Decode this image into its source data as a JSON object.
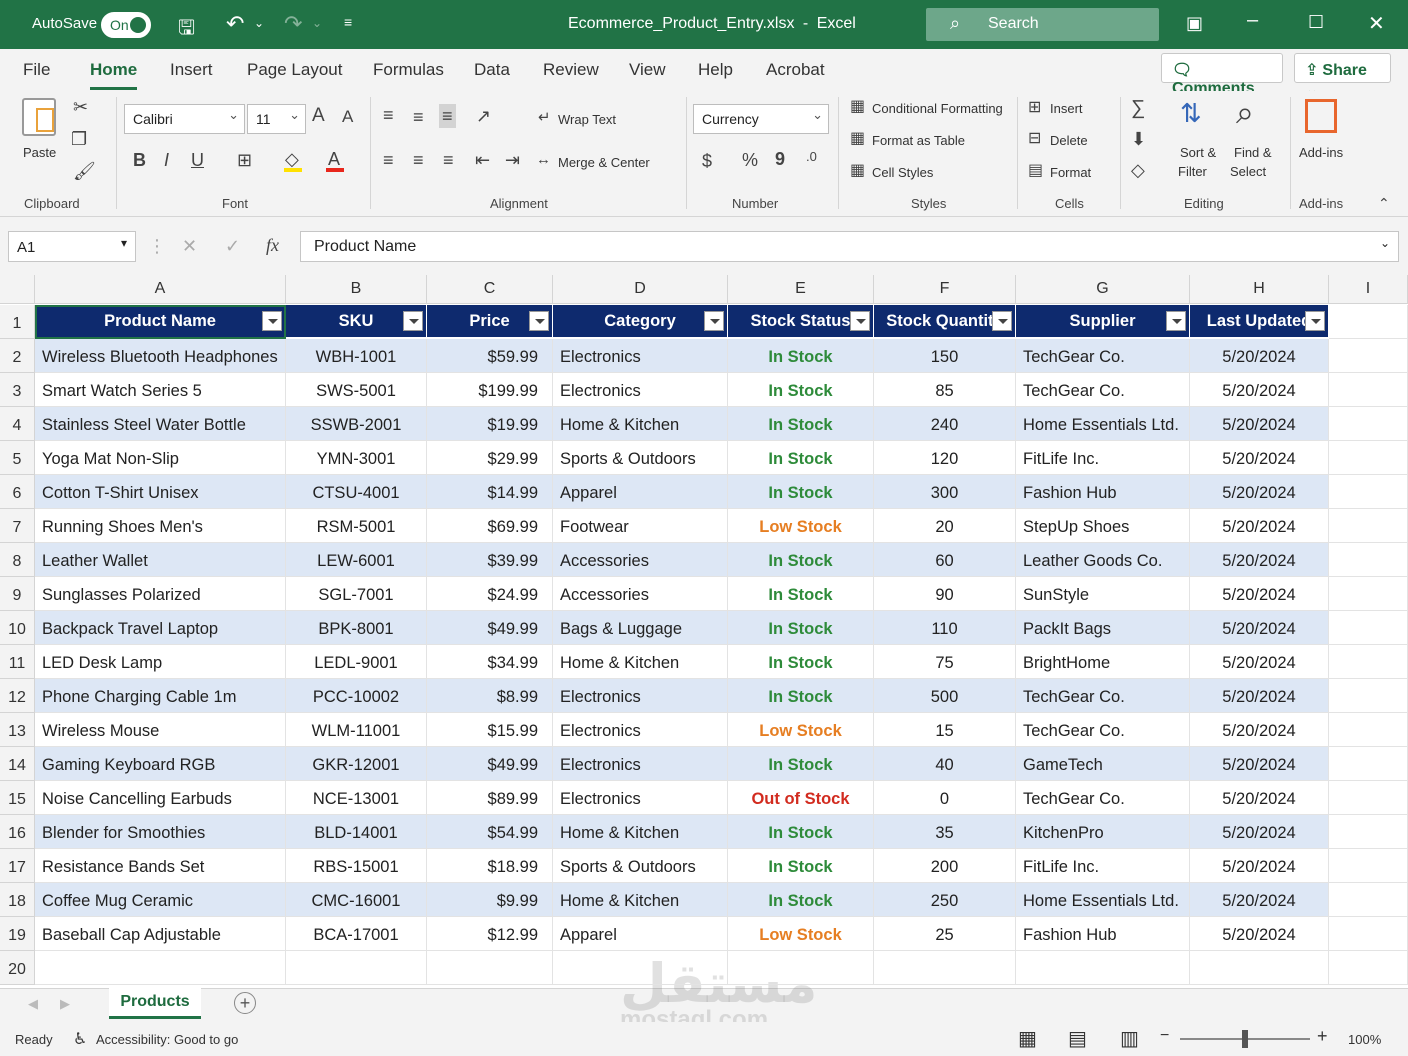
{
  "titlebar": {
    "autosave_label": "AutoSave",
    "autosave_state": "On",
    "filename": "Ecommerce_Product_Entry.xlsx",
    "separator": "-",
    "app": "Excel",
    "search_placeholder": "Search"
  },
  "menu": {
    "tabs": [
      "File",
      "Home",
      "Insert",
      "Page Layout",
      "Formulas",
      "Data",
      "Review",
      "View",
      "Help",
      "Acrobat"
    ],
    "comments": "Comments",
    "share": "Share"
  },
  "ribbon": {
    "clipboard": {
      "paste": "Paste",
      "group": "Clipboard"
    },
    "font": {
      "name": "Calibri",
      "size": "11",
      "group": "Font",
      "bold": "B",
      "italic": "I",
      "underline": "U",
      "grow": "A",
      "shrink": "A"
    },
    "alignment": {
      "wrap": "Wrap Text",
      "merge": "Merge & Center",
      "group": "Alignment"
    },
    "number": {
      "format": "Currency",
      "currency": "$",
      "percent": "%",
      "comma": "9",
      "group": "Number"
    },
    "styles": {
      "cond": "Conditional Formatting",
      "table": "Format as Table",
      "cell": "Cell Styles",
      "group": "Styles"
    },
    "cells": {
      "insert": "Insert",
      "delete": "Delete",
      "format": "Format",
      "group": "Cells"
    },
    "editing": {
      "sort1": "Sort &",
      "sort2": "Filter",
      "find1": "Find &",
      "find2": "Select",
      "group": "Editing"
    },
    "addins": {
      "label": "Add-ins",
      "group": "Add-ins"
    }
  },
  "formula_bar": {
    "name_box": "A1",
    "fx": "fx",
    "content": "Product Name"
  },
  "columns": [
    "A",
    "B",
    "C",
    "D",
    "E",
    "F",
    "G",
    "H",
    "I"
  ],
  "headers": [
    "Product Name",
    "SKU",
    "Price",
    "Category",
    "Stock Status",
    "Stock Quantity",
    "Supplier",
    "Last Updated"
  ],
  "status_colors": {
    "In Stock": "#2e8b3a",
    "Low Stock": "#e67e22",
    "Out of Stock": "#d22b1f"
  },
  "rows": [
    [
      "Wireless Bluetooth Headphones",
      "WBH-1001",
      "$59.99",
      "Electronics",
      "In Stock",
      "150",
      "TechGear Co.",
      "5/20/2024"
    ],
    [
      "Smart Watch Series 5",
      "SWS-5001",
      "$199.99",
      "Electronics",
      "In Stock",
      "85",
      "TechGear Co.",
      "5/20/2024"
    ],
    [
      "Stainless Steel Water Bottle",
      "SSWB-2001",
      "$19.99",
      "Home & Kitchen",
      "In Stock",
      "240",
      "Home Essentials Ltd.",
      "5/20/2024"
    ],
    [
      "Yoga Mat Non-Slip",
      "YMN-3001",
      "$29.99",
      "Sports & Outdoors",
      "In Stock",
      "120",
      "FitLife Inc.",
      "5/20/2024"
    ],
    [
      "Cotton T-Shirt Unisex",
      "CTSU-4001",
      "$14.99",
      "Apparel",
      "In Stock",
      "300",
      "Fashion Hub",
      "5/20/2024"
    ],
    [
      "Running Shoes Men's",
      "RSM-5001",
      "$69.99",
      "Footwear",
      "Low Stock",
      "20",
      "StepUp Shoes",
      "5/20/2024"
    ],
    [
      "Leather Wallet",
      "LEW-6001",
      "$39.99",
      "Accessories",
      "In Stock",
      "60",
      "Leather Goods Co.",
      "5/20/2024"
    ],
    [
      "Sunglasses Polarized",
      "SGL-7001",
      "$24.99",
      "Accessories",
      "In Stock",
      "90",
      "SunStyle",
      "5/20/2024"
    ],
    [
      "Backpack Travel Laptop",
      "BPK-8001",
      "$49.99",
      "Bags & Luggage",
      "In Stock",
      "110",
      "PackIt Bags",
      "5/20/2024"
    ],
    [
      "LED Desk Lamp",
      "LEDL-9001",
      "$34.99",
      "Home & Kitchen",
      "In Stock",
      "75",
      "BrightHome",
      "5/20/2024"
    ],
    [
      "Phone Charging Cable 1m",
      "PCC-10002",
      "$8.99",
      "Electronics",
      "In Stock",
      "500",
      "TechGear Co.",
      "5/20/2024"
    ],
    [
      "Wireless Mouse",
      "WLM-11001",
      "$15.99",
      "Electronics",
      "Low Stock",
      "15",
      "TechGear Co.",
      "5/20/2024"
    ],
    [
      "Gaming Keyboard RGB",
      "GKR-12001",
      "$49.99",
      "Electronics",
      "In Stock",
      "40",
      "GameTech",
      "5/20/2024"
    ],
    [
      "Noise Cancelling Earbuds",
      "NCE-13001",
      "$89.99",
      "Electronics",
      "Out of Stock",
      "0",
      "TechGear Co.",
      "5/20/2024"
    ],
    [
      "Blender for Smoothies",
      "BLD-14001",
      "$54.99",
      "Home & Kitchen",
      "In Stock",
      "35",
      "KitchenPro",
      "5/20/2024"
    ],
    [
      "Resistance Bands Set",
      "RBS-15001",
      "$18.99",
      "Sports & Outdoors",
      "In Stock",
      "200",
      "FitLife Inc.",
      "5/20/2024"
    ],
    [
      "Coffee Mug Ceramic",
      "CMC-16001",
      "$9.99",
      "Home & Kitchen",
      "In Stock",
      "250",
      "Home Essentials Ltd.",
      "5/20/2024"
    ],
    [
      "Baseball Cap Adjustable",
      "BCA-17001",
      "$12.99",
      "Apparel",
      "Low Stock",
      "25",
      "Fashion Hub",
      "5/20/2024"
    ]
  ],
  "sheet": {
    "tab": "Products"
  },
  "statusbar": {
    "ready": "Ready",
    "accessibility": "Accessibility: Good to go",
    "zoom": "100%"
  },
  "watermark": {
    "arabic": "مستقل",
    "latin": "mostaql.com"
  }
}
